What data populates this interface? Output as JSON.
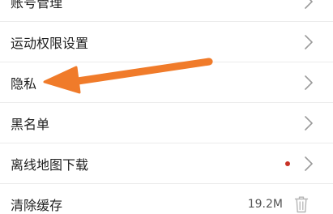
{
  "settings_list": {
    "items": [
      {
        "label": "账号管理",
        "icon": "chevron-right-icon"
      },
      {
        "label": "运动权限设置",
        "icon": "chevron-right-icon"
      },
      {
        "label": "隐私",
        "icon": "chevron-right-icon"
      },
      {
        "label": "黑名单",
        "icon": "chevron-right-icon"
      },
      {
        "label": "离线地图下载",
        "icon": "chevron-right-icon",
        "badge": "red-dot"
      },
      {
        "label": "清除缓存",
        "value": "19.2M",
        "icon": "trash-icon"
      }
    ]
  },
  "annotation": {
    "type": "arrow",
    "color": "#f07b2a",
    "points_to": "隐私"
  },
  "colors": {
    "background": "#ffffff",
    "text": "#1f1f1f",
    "divider": "#ececec",
    "chevron": "#9a9a9a",
    "badge_dot": "#c83226",
    "arrow": "#f07b2a"
  }
}
